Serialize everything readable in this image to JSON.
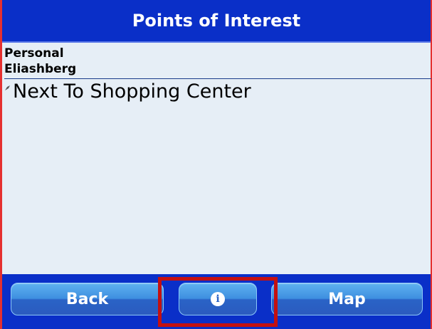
{
  "header": {
    "title": "Points of Interest"
  },
  "content": {
    "category": "Personal",
    "subcategory": "Eliashberg",
    "items": [
      {
        "label": "Next To Shopping Center",
        "icon": "pin-icon"
      }
    ]
  },
  "buttons": {
    "back": "Back",
    "info_icon": "info-icon",
    "map": "Map"
  },
  "colors": {
    "titlebar": "#0a2fc8",
    "content_bg": "#e6eef6",
    "button": "#3e8fe0",
    "highlight": "#c41010"
  }
}
